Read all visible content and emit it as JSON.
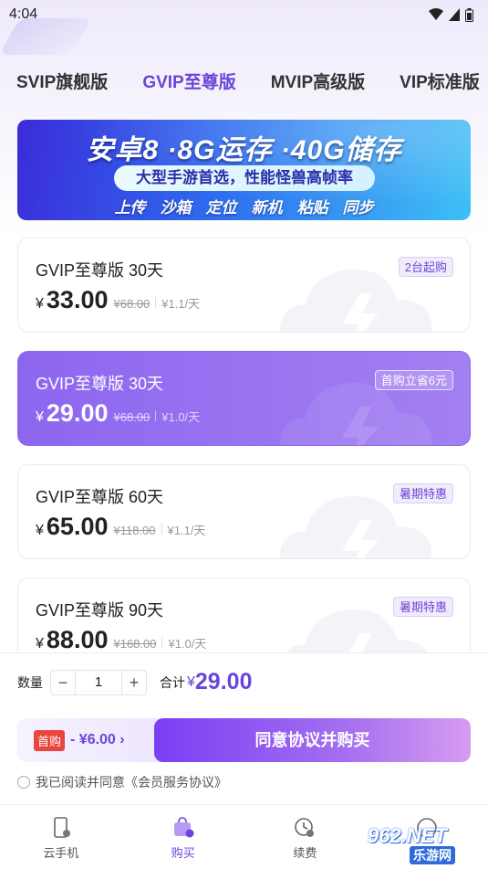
{
  "status_bar": {
    "time": "4:04"
  },
  "tabs": [
    {
      "label": "SVIP旗舰版",
      "active": false
    },
    {
      "label": "GVIP至尊版",
      "active": true
    },
    {
      "label": "MVIP高级版",
      "active": false
    },
    {
      "label": "VIP标准版",
      "active": false
    }
  ],
  "banner": {
    "title": "安卓8 ·8G运存 ·40G储存",
    "subtitle": "大型手游首选，性能怪兽高帧率",
    "features": [
      "上传",
      "沙箱",
      "定位",
      "新机",
      "粘贴",
      "同步"
    ]
  },
  "plans": [
    {
      "name": "GVIP至尊版 30天",
      "badge": "2台起购",
      "currency": "¥",
      "price": "33.00",
      "original": "¥68.00",
      "per_day": "¥1.1/天",
      "selected": false
    },
    {
      "name": "GVIP至尊版 30天",
      "badge": "首购立省6元",
      "currency": "¥",
      "price": "29.00",
      "original": "¥68.00",
      "per_day": "¥1.0/天",
      "selected": true
    },
    {
      "name": "GVIP至尊版 60天",
      "badge": "暑期特惠",
      "currency": "¥",
      "price": "65.00",
      "original": "¥118.00",
      "per_day": "¥1.1/天",
      "selected": false
    },
    {
      "name": "GVIP至尊版 90天",
      "badge": "暑期特惠",
      "currency": "¥",
      "price": "88.00",
      "original": "¥168.00",
      "per_day": "¥1.0/天",
      "selected": false
    }
  ],
  "order": {
    "qty_label": "数量",
    "minus": "−",
    "quantity": "1",
    "plus": "+",
    "total_label": "合计",
    "total_currency": "¥",
    "total": "29.00"
  },
  "buy": {
    "first_tag": "首购",
    "discount": "- ¥6.00 ›",
    "button": "同意协议并购买"
  },
  "agreement": {
    "text": "我已阅读并同意《会员服务协议》"
  },
  "nav": [
    {
      "label": "云手机",
      "icon": "phone-icon",
      "active": false
    },
    {
      "label": "购买",
      "icon": "shop-bag-icon",
      "active": true
    },
    {
      "label": "续费",
      "icon": "renew-clock-icon",
      "active": false
    },
    {
      "label": "",
      "icon": "profile-icon",
      "active": false
    }
  ],
  "watermark": {
    "text": "962.NET",
    "sub": "乐游网"
  },
  "colors": {
    "accent": "#6b45d9",
    "selected_card": "#8d66ef",
    "first_tag": "#e8463e"
  }
}
